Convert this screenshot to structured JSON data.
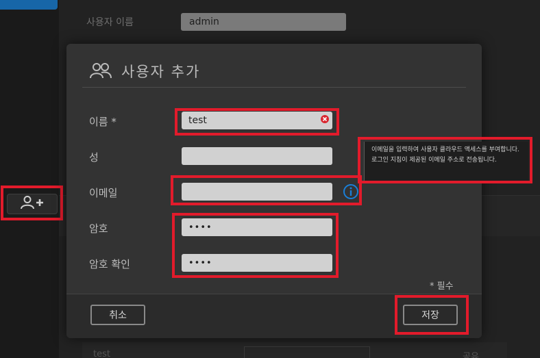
{
  "background": {
    "username_label": "사용자 이름",
    "username_value": "admin",
    "bottom_row_text": "test",
    "bottom_row_right": "공유"
  },
  "dialog": {
    "title": "사용자 추가",
    "fields": {
      "first_name": {
        "label": "이름 *",
        "value": "test"
      },
      "last_name": {
        "label": "성",
        "value": ""
      },
      "email": {
        "label": "이메일",
        "value": ""
      },
      "password": {
        "label": "암호",
        "value": "••••"
      },
      "confirm_password": {
        "label": "암호 확인",
        "value": "••••"
      }
    },
    "required_note": "* 필수",
    "cancel_label": "취소",
    "save_label": "저장"
  },
  "tooltip": {
    "text": "이메일을 입력하여 사용자 클라우드 액세스를 부여합니다. 로그인 지침이 제공된 이메일 주소로 전송됩니다."
  },
  "icons": {
    "add_user": "add-user-icon",
    "users": "users-icon",
    "clear": "clear-icon",
    "info": "info-icon"
  },
  "colors": {
    "highlight": "#e21b2b",
    "dialog_bg": "#333333",
    "field_bg": "#d1d1d1",
    "info_blue": "#1a7fd8",
    "clear_red": "#d9262f"
  }
}
